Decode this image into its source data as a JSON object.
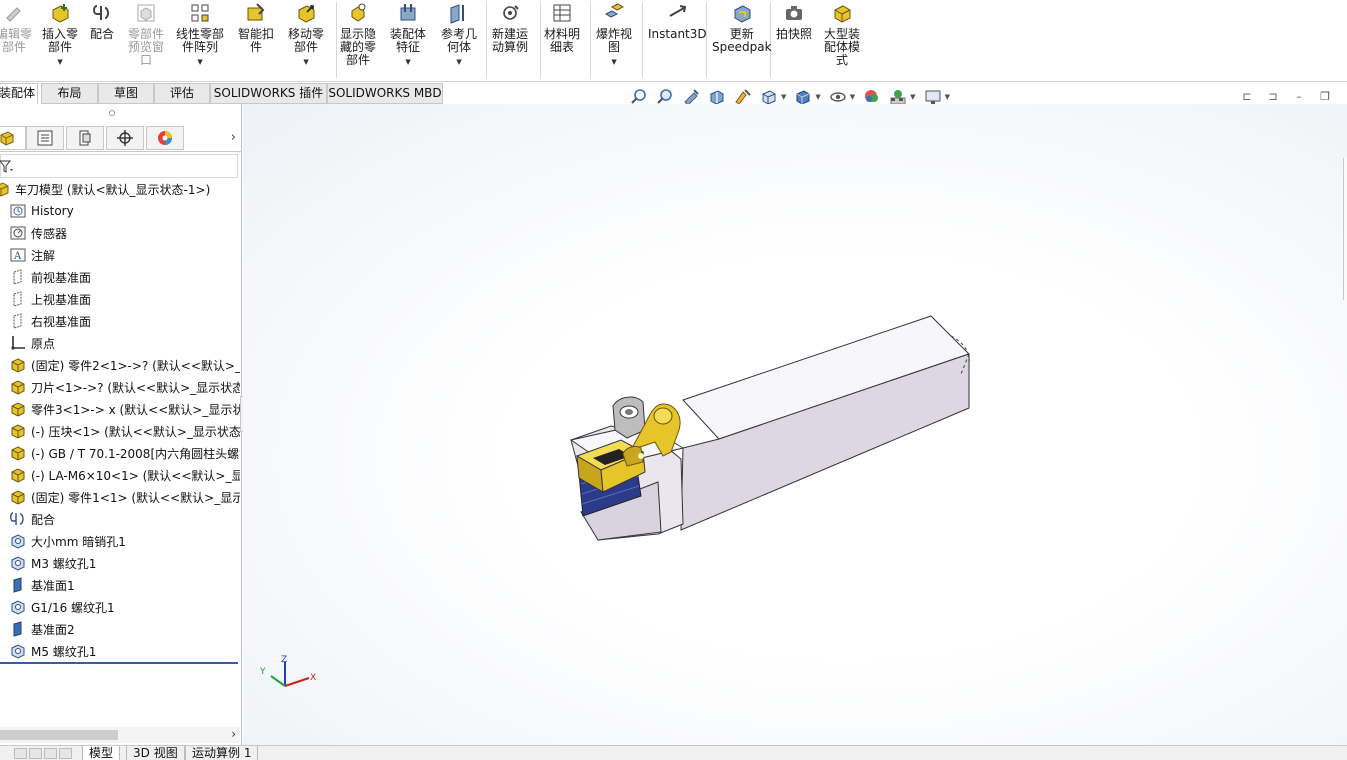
{
  "ribbon": {
    "buttons": [
      {
        "id": "edit-component",
        "label": "编辑零\n部件",
        "disabled": true,
        "dropdown": false
      },
      {
        "id": "insert-component",
        "label": "插入零\n部件",
        "disabled": false,
        "dropdown": true
      },
      {
        "id": "mate",
        "label": "配合",
        "disabled": false,
        "dropdown": false
      },
      {
        "id": "component-preview",
        "label": "零部件\n预览窗\n口",
        "disabled": true,
        "dropdown": false
      },
      {
        "id": "linear-pattern",
        "label": "线性零部\n件阵列",
        "disabled": false,
        "dropdown": true
      },
      {
        "id": "smart-fasteners",
        "label": "智能扣\n件",
        "disabled": false,
        "dropdown": false
      },
      {
        "id": "move-component",
        "label": "移动零\n部件",
        "disabled": false,
        "dropdown": true
      },
      {
        "id": "show-hidden",
        "label": "显示隐\n藏的零\n部件",
        "disabled": false,
        "dropdown": false
      },
      {
        "id": "assembly-features",
        "label": "装配体\n特征",
        "disabled": false,
        "dropdown": true
      },
      {
        "id": "reference-geometry",
        "label": "参考几\n何体",
        "disabled": false,
        "dropdown": true
      },
      {
        "id": "new-motion-study",
        "label": "新建运\n动算例",
        "disabled": false,
        "dropdown": false
      },
      {
        "id": "bill-of-materials",
        "label": "材料明\n细表",
        "disabled": false,
        "dropdown": false
      },
      {
        "id": "exploded-view",
        "label": "爆炸视\n图",
        "disabled": false,
        "dropdown": true
      },
      {
        "id": "instant3d",
        "label": "Instant3D",
        "disabled": false,
        "dropdown": false
      },
      {
        "id": "update-speedpak",
        "label": "更新\nSpeedpak",
        "disabled": false,
        "dropdown": false
      },
      {
        "id": "take-snapshot",
        "label": "拍快照",
        "disabled": false,
        "dropdown": false
      },
      {
        "id": "large-assembly-mode",
        "label": "大型装\n配体模\n式",
        "disabled": false,
        "dropdown": false
      }
    ]
  },
  "command_tabs": [
    "装配体",
    "布局",
    "草图",
    "评估",
    "SOLIDWORKS 插件",
    "SOLIDWORKS MBD"
  ],
  "active_command_tab": "装配体",
  "feature_tree": {
    "root": "车刀模型 (默认<默认_显示状态-1>)",
    "items": [
      {
        "icon": "history-icon",
        "label": "History"
      },
      {
        "icon": "sensor-icon",
        "label": "传感器"
      },
      {
        "icon": "annotation-icon",
        "label": "注解"
      },
      {
        "icon": "plane-icon",
        "label": "前视基准面"
      },
      {
        "icon": "plane-icon",
        "label": "上视基准面"
      },
      {
        "icon": "plane-icon",
        "label": "右视基准面"
      },
      {
        "icon": "origin-icon",
        "label": "原点"
      },
      {
        "icon": "part-icon",
        "label": "(固定) 零件2<1>->? (默认<<默认>_显"
      },
      {
        "icon": "part-icon",
        "label": "刀片<1>->? (默认<<默认>_显示状态"
      },
      {
        "icon": "part-icon",
        "label": "零件3<1>-> x (默认<<默认>_显示状"
      },
      {
        "icon": "part-icon",
        "label": "(-) 压块<1> (默认<<默认>_显示状态"
      },
      {
        "icon": "part-icon",
        "label": "(-) GB / T 70.1-2008[内六角圆柱头螺钉"
      },
      {
        "icon": "part-icon",
        "label": "(-) LA-M6×10<1> (默认<<默认>_显"
      },
      {
        "icon": "part-icon",
        "label": "(固定) 零件1<1> (默认<<默认>_显示"
      },
      {
        "icon": "mates-icon",
        "label": "配合"
      },
      {
        "icon": "hole-icon",
        "label": "大小mm 暗销孔1"
      },
      {
        "icon": "hole-icon",
        "label": "M3 螺纹孔1"
      },
      {
        "icon": "plane-feature-icon",
        "label": "基准面1"
      },
      {
        "icon": "hole-icon",
        "label": "G1/16 螺纹孔1"
      },
      {
        "icon": "plane-feature-icon",
        "label": "基准面2"
      },
      {
        "icon": "hole-icon",
        "label": "M5 螺纹孔1"
      }
    ]
  },
  "bottom_tabs": [
    "模型",
    "3D 视图",
    "运动算例 1"
  ],
  "active_bottom_tab": "模型",
  "triad": {
    "x": "X",
    "y": "Y",
    "z": "Z"
  },
  "colors": {
    "accent": "#2f5fa8",
    "part_body": "#e8e4ec",
    "insert_gold": "#e6c52a"
  }
}
